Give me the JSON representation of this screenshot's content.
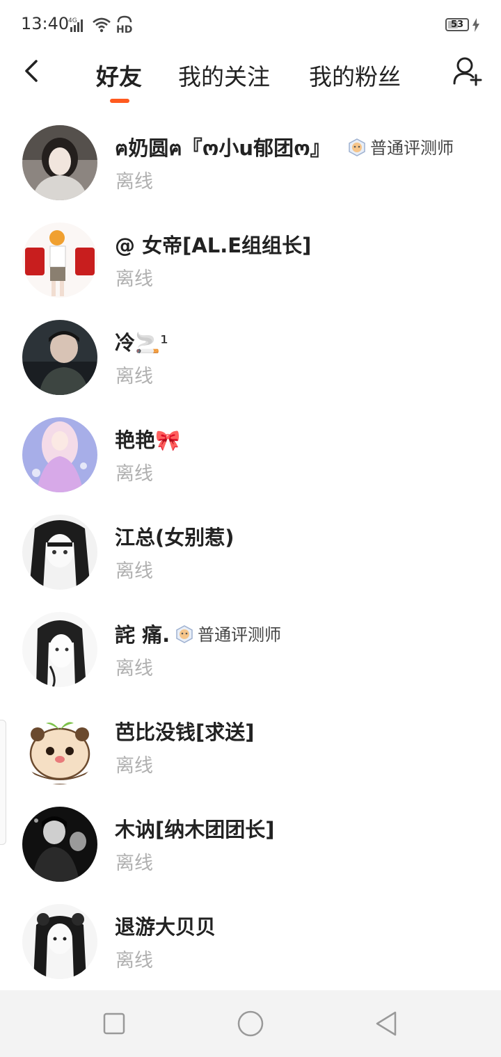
{
  "status_bar": {
    "time": "13:40",
    "network": "4G",
    "hd_label": "HD",
    "battery_level": 53,
    "battery_text": "53"
  },
  "nav": {
    "tabs": [
      {
        "label": "好友",
        "active": true
      },
      {
        "label": "我的关注",
        "active": false
      },
      {
        "label": "我的粉丝",
        "active": false
      }
    ],
    "accent_color": "#ff5a1f"
  },
  "friends": [
    {
      "name": "ฅ奶圆ฅ『ო小u郁团ო』",
      "status": "离线",
      "badge": "普通评测师"
    },
    {
      "name": "@  女帝[AL.E组组长]",
      "status": "离线",
      "badge": ""
    },
    {
      "name": "冷",
      "name_emoji": "🚬¹",
      "status": "离线",
      "badge": ""
    },
    {
      "name": "艳艳",
      "name_emoji": "🎀",
      "status": "离线",
      "badge": ""
    },
    {
      "name": "江总(女别惹)",
      "status": "离线",
      "badge": ""
    },
    {
      "name": "詫 痛.",
      "status": "离线",
      "badge": "普通评测师"
    },
    {
      "name": "芭比没钱[求送]",
      "status": "离线",
      "badge": ""
    },
    {
      "name": "木讷[纳木团团长]",
      "status": "离线",
      "badge": ""
    },
    {
      "name": "退游大贝贝",
      "status": "离线",
      "badge": ""
    }
  ],
  "colors": {
    "status_offline": "#b0b0b0",
    "text_primary": "#222222",
    "sys_nav_bg": "#f3f3f3"
  }
}
